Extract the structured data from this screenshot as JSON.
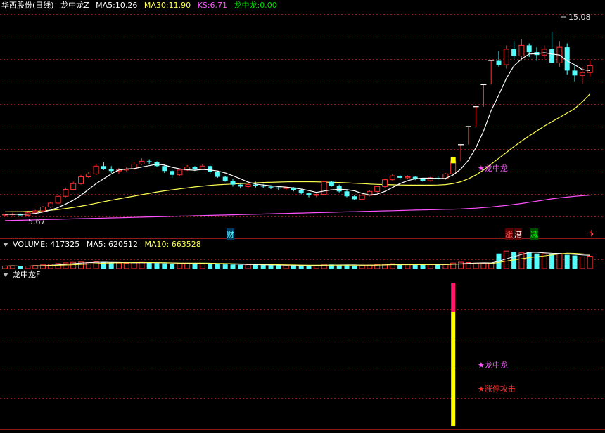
{
  "header": {
    "stock_name": "华西股份",
    "period": "(日线)",
    "indicator": "龙中龙Z",
    "ma5_label": "MA5:",
    "ma5_value": "10.26",
    "ma30_label": "MA30:",
    "ma30_value": "11.90",
    "ks_label": "KS:",
    "ks_value": "6.71",
    "lzl_label": "龙中龙:",
    "lzl_value": "0.00"
  },
  "volume_header": {
    "label": "VOLUME:",
    "value": "417325",
    "ma5_label": "MA5:",
    "ma5_value": "620512",
    "ma10_label": "MA10:",
    "ma10_value": "663528"
  },
  "bottom_header": {
    "title": "龙中龙F"
  },
  "price_labels": {
    "high": "15.08",
    "low": "5.67"
  },
  "markers": {
    "cai": "财",
    "zhang": "涨",
    "gang": "港",
    "jian": "减",
    "s": "$",
    "signal_main": "★龙中龙",
    "signal_bottom_1": "★龙中龙",
    "signal_bottom_2": "★涨停攻击"
  },
  "colors": {
    "up": "#ff3232",
    "down": "#54fcfc",
    "ma5": "#ffffff",
    "ma30": "#ffff54",
    "ks": "#ff54ff",
    "lzl": "#00e000",
    "grid": "#8b1a1a",
    "bar_yellow": "#ffff00",
    "bar_pink": "#ff1a6e"
  },
  "chart_data": {
    "type": "candlestick",
    "price_range": [
      5.0,
      16.0
    ],
    "candles": [
      [
        5.7,
        5.75,
        5.65,
        5.72
      ],
      [
        5.72,
        5.8,
        5.66,
        5.74
      ],
      [
        5.74,
        5.78,
        5.62,
        5.67
      ],
      [
        5.67,
        5.85,
        5.65,
        5.8
      ],
      [
        5.8,
        5.95,
        5.76,
        5.9
      ],
      [
        5.9,
        6.15,
        5.88,
        6.1
      ],
      [
        6.1,
        6.35,
        6.05,
        6.3
      ],
      [
        6.3,
        6.7,
        6.25,
        6.65
      ],
      [
        6.65,
        7.1,
        6.6,
        7.0
      ],
      [
        7.0,
        7.4,
        6.95,
        7.3
      ],
      [
        7.3,
        7.75,
        7.25,
        7.65
      ],
      [
        7.65,
        7.9,
        7.6,
        7.8
      ],
      [
        7.8,
        8.3,
        7.75,
        8.2
      ],
      [
        8.2,
        8.4,
        8.0,
        8.05
      ],
      [
        8.05,
        8.2,
        7.85,
        7.95
      ],
      [
        7.95,
        8.1,
        7.8,
        8.0
      ],
      [
        8.0,
        8.15,
        7.9,
        8.05
      ],
      [
        8.05,
        8.4,
        8.0,
        8.3
      ],
      [
        8.3,
        8.6,
        8.25,
        8.45
      ],
      [
        8.45,
        8.55,
        8.3,
        8.4
      ],
      [
        8.4,
        8.45,
        8.15,
        8.2
      ],
      [
        8.2,
        8.25,
        7.85,
        7.95
      ],
      [
        7.95,
        8.0,
        7.6,
        7.75
      ],
      [
        7.75,
        8.05,
        7.7,
        8.0
      ],
      [
        8.0,
        8.25,
        7.95,
        8.15
      ],
      [
        8.15,
        8.2,
        7.95,
        8.05
      ],
      [
        8.05,
        8.3,
        8.0,
        8.2
      ],
      [
        8.2,
        8.25,
        7.8,
        7.9
      ],
      [
        7.9,
        7.95,
        7.6,
        7.65
      ],
      [
        7.65,
        7.7,
        7.4,
        7.45
      ],
      [
        7.45,
        7.55,
        7.15,
        7.25
      ],
      [
        7.25,
        7.35,
        7.05,
        7.15
      ],
      [
        7.15,
        7.3,
        7.05,
        7.25
      ],
      [
        7.25,
        7.4,
        7.1,
        7.2
      ],
      [
        7.2,
        7.28,
        7.08,
        7.15
      ],
      [
        7.15,
        7.22,
        7.02,
        7.1
      ],
      [
        7.1,
        7.18,
        6.98,
        7.05
      ],
      [
        7.05,
        7.15,
        6.95,
        7.1
      ],
      [
        7.1,
        7.12,
        6.9,
        6.95
      ],
      [
        6.95,
        7.0,
        6.75,
        6.8
      ],
      [
        6.8,
        6.85,
        6.6,
        6.7
      ],
      [
        6.7,
        6.8,
        6.6,
        6.75
      ],
      [
        6.75,
        7.45,
        6.7,
        7.4
      ],
      [
        7.4,
        7.45,
        7.15,
        7.2
      ],
      [
        7.2,
        7.25,
        6.85,
        6.9
      ],
      [
        6.9,
        6.95,
        6.6,
        6.65
      ],
      [
        6.65,
        6.7,
        6.45,
        6.5
      ],
      [
        6.5,
        6.75,
        6.45,
        6.7
      ],
      [
        6.7,
        6.95,
        6.65,
        6.9
      ],
      [
        6.9,
        7.2,
        6.85,
        7.15
      ],
      [
        7.15,
        7.55,
        7.1,
        7.5
      ],
      [
        7.5,
        7.8,
        7.45,
        7.7
      ],
      [
        7.7,
        7.75,
        7.5,
        7.6
      ],
      [
        7.6,
        7.72,
        7.52,
        7.65
      ],
      [
        7.65,
        7.68,
        7.48,
        7.55
      ],
      [
        7.55,
        7.6,
        7.4,
        7.45
      ],
      [
        7.45,
        7.65,
        7.4,
        7.6
      ],
      [
        7.6,
        7.7,
        7.5,
        7.55
      ],
      [
        7.55,
        7.85,
        7.5,
        7.8
      ],
      [
        7.8,
        8.55,
        7.75,
        8.45
      ],
      [
        8.45,
        9.3,
        8.45,
        9.3
      ],
      [
        9.3,
        10.23,
        9.3,
        10.23
      ],
      [
        10.23,
        11.25,
        10.23,
        11.25
      ],
      [
        11.25,
        12.38,
        11.25,
        12.38
      ],
      [
        12.38,
        13.62,
        12.38,
        13.62
      ],
      [
        13.6,
        14.1,
        13.3,
        13.4
      ],
      [
        13.4,
        14.4,
        13.2,
        14.2
      ],
      [
        14.2,
        14.6,
        13.7,
        13.85
      ],
      [
        13.85,
        14.7,
        13.6,
        14.4
      ],
      [
        14.4,
        14.5,
        13.8,
        14.05
      ],
      [
        14.05,
        14.3,
        13.6,
        13.9
      ],
      [
        13.9,
        14.4,
        13.7,
        14.2
      ],
      [
        14.2,
        15.08,
        14.1,
        13.5
      ],
      [
        13.5,
        14.6,
        13.3,
        14.3
      ],
      [
        14.3,
        14.5,
        12.9,
        13.1
      ],
      [
        13.1,
        13.4,
        12.55,
        12.85
      ],
      [
        12.85,
        13.3,
        12.4,
        13.0
      ],
      [
        13.0,
        13.6,
        12.8,
        13.35
      ]
    ],
    "volumes": [
      150,
      160,
      140,
      150,
      180,
      220,
      260,
      300,
      340,
      370,
      390,
      360,
      400,
      380,
      340,
      330,
      320,
      350,
      370,
      360,
      330,
      310,
      300,
      310,
      320,
      300,
      310,
      290,
      270,
      250,
      240,
      220,
      230,
      220,
      210,
      200,
      190,
      200,
      190,
      180,
      170,
      180,
      260,
      240,
      210,
      190,
      180,
      200,
      210,
      230,
      260,
      290,
      260,
      250,
      240,
      220,
      230,
      240,
      250,
      330,
      380,
      360,
      330,
      310,
      300,
      900,
      1050,
      1000,
      940,
      980,
      900,
      880,
      860,
      900,
      820,
      780,
      700,
      740
    ],
    "ma5": [
      5.72,
      5.73,
      5.72,
      5.73,
      5.77,
      5.84,
      5.94,
      6.07,
      6.25,
      6.45,
      6.7,
      7.0,
      7.3,
      7.55,
      7.8,
      8.0,
      8.05,
      8.07,
      8.15,
      8.22,
      8.3,
      8.25,
      8.14,
      8.06,
      8.01,
      7.99,
      8.03,
      8.0,
      7.95,
      7.85,
      7.7,
      7.55,
      7.38,
      7.28,
      7.23,
      7.19,
      7.15,
      7.12,
      7.08,
      7.02,
      6.94,
      6.85,
      6.92,
      6.98,
      7.01,
      6.99,
      6.93,
      6.8,
      6.72,
      6.76,
      6.9,
      7.1,
      7.3,
      7.45,
      7.55,
      7.58,
      7.58,
      7.56,
      7.57,
      7.75,
      8.05,
      8.5,
      9.15,
      10.0,
      11.05,
      11.85,
      12.7,
      13.35,
      13.7,
      13.95,
      13.97,
      14.02,
      13.95,
      13.9,
      13.6,
      13.4,
      13.15,
      13.1
    ],
    "ma30": [
      5.85,
      5.86,
      5.86,
      5.87,
      5.88,
      5.9,
      5.93,
      5.97,
      6.02,
      6.08,
      6.14,
      6.21,
      6.29,
      6.37,
      6.45,
      6.52,
      6.59,
      6.66,
      6.73,
      6.8,
      6.87,
      6.93,
      6.98,
      7.03,
      7.08,
      7.13,
      7.17,
      7.21,
      7.24,
      7.26,
      7.28,
      7.3,
      7.32,
      7.34,
      7.36,
      7.37,
      7.38,
      7.39,
      7.4,
      7.4,
      7.4,
      7.39,
      7.38,
      7.37,
      7.36,
      7.34,
      7.32,
      7.3,
      7.28,
      7.26,
      7.25,
      7.24,
      7.23,
      7.22,
      7.22,
      7.22,
      7.22,
      7.23,
      7.25,
      7.3,
      7.4,
      7.55,
      7.75,
      8.0,
      8.3,
      8.6,
      8.9,
      9.2,
      9.48,
      9.75,
      10.0,
      10.25,
      10.48,
      10.7,
      10.92,
      11.15,
      11.5,
      11.9
    ],
    "ks": [
      5.4,
      5.41,
      5.42,
      5.43,
      5.44,
      5.45,
      5.46,
      5.47,
      5.48,
      5.49,
      5.5,
      5.51,
      5.52,
      5.53,
      5.54,
      5.55,
      5.56,
      5.57,
      5.58,
      5.59,
      5.6,
      5.61,
      5.62,
      5.63,
      5.64,
      5.65,
      5.66,
      5.67,
      5.68,
      5.69,
      5.7,
      5.71,
      5.72,
      5.73,
      5.74,
      5.75,
      5.76,
      5.77,
      5.78,
      5.79,
      5.8,
      5.81,
      5.82,
      5.83,
      5.84,
      5.85,
      5.86,
      5.87,
      5.88,
      5.89,
      5.9,
      5.91,
      5.92,
      5.93,
      5.94,
      5.95,
      5.96,
      5.97,
      5.98,
      5.99,
      6.0,
      6.02,
      6.04,
      6.07,
      6.1,
      6.14,
      6.18,
      6.23,
      6.28,
      6.34,
      6.4,
      6.46,
      6.52,
      6.57,
      6.61,
      6.65,
      6.68,
      6.71
    ],
    "signal_index": 59,
    "limit_up_start": 60
  }
}
